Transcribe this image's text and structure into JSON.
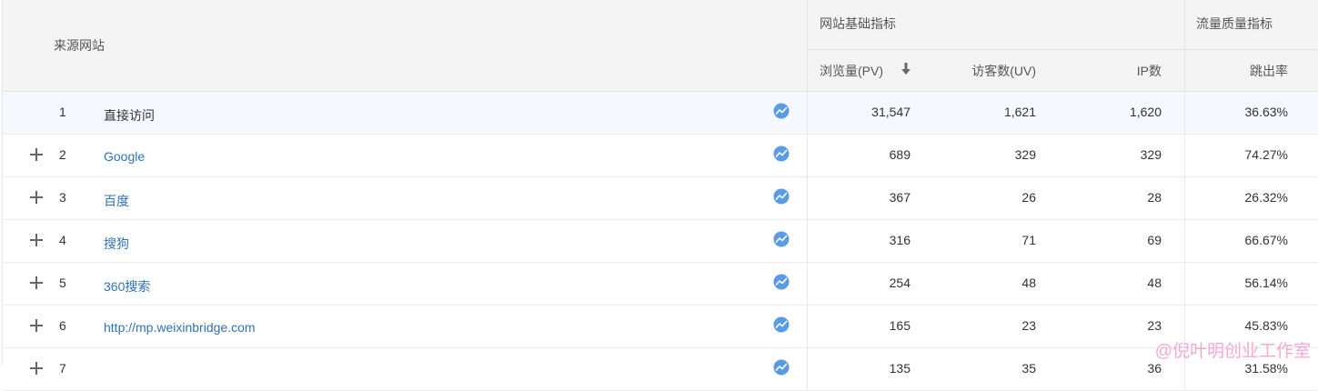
{
  "header": {
    "source_col": "来源网站",
    "group_basic": "网站基础指标",
    "group_quality": "流量质量指标",
    "pv": "浏览量(PV)",
    "uv": "访客数(UV)",
    "ip": "IP数",
    "bounce": "跳出率"
  },
  "rows": [
    {
      "index": "1",
      "source": "直接访问",
      "pv": "31,547",
      "uv": "1,621",
      "ip": "1,620",
      "bounce": "36.63%"
    },
    {
      "index": "2",
      "source": "Google",
      "pv": "689",
      "uv": "329",
      "ip": "329",
      "bounce": "74.27%"
    },
    {
      "index": "3",
      "source": "百度",
      "pv": "367",
      "uv": "26",
      "ip": "28",
      "bounce": "26.32%"
    },
    {
      "index": "4",
      "source": "搜狗",
      "pv": "316",
      "uv": "71",
      "ip": "69",
      "bounce": "66.67%"
    },
    {
      "index": "5",
      "source": "360搜索",
      "pv": "254",
      "uv": "48",
      "ip": "48",
      "bounce": "56.14%"
    },
    {
      "index": "6",
      "source": "http://mp.weixinbridge.com",
      "pv": "165",
      "uv": "23",
      "ip": "23",
      "bounce": "45.83%"
    },
    {
      "index": "7",
      "source": "",
      "pv": "135",
      "uv": "35",
      "ip": "36",
      "bounce": "31.58%"
    }
  ],
  "watermark": "@倪叶明创业工作室",
  "colors": {
    "link": "#2f73b8",
    "header_bg": "#f4f4f4",
    "selected_row": "#f6f8ff",
    "trend_icon": "#5b9be6"
  }
}
